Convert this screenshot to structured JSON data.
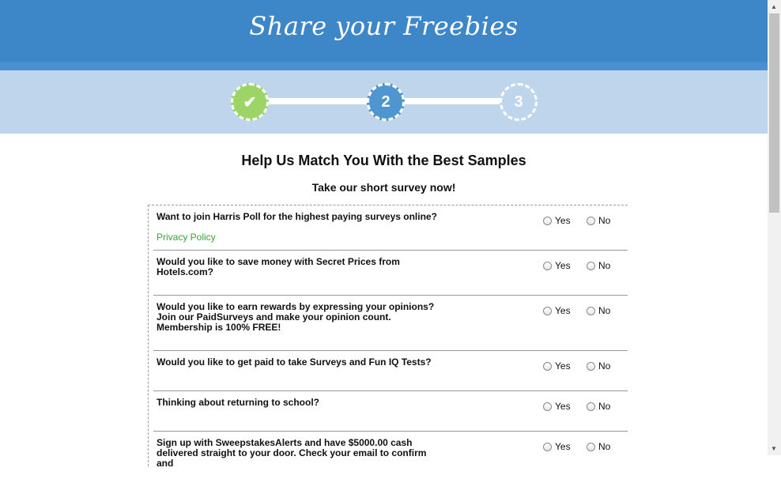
{
  "header": {
    "brand": "Share your Freebies"
  },
  "progress": {
    "steps": [
      {
        "label": "✔"
      },
      {
        "label": "2"
      },
      {
        "label": "3"
      }
    ]
  },
  "main": {
    "title": "Help Us Match You With the Best Samples",
    "subtitle": "Take our short survey now!",
    "yes_label": "Yes",
    "no_label": "No",
    "questions": [
      {
        "text": "Want to join Harris Poll for the highest paying surveys online?",
        "link": "Privacy Policy"
      },
      {
        "text": "Would you like to save money with Secret Prices from Hotels.com?"
      },
      {
        "text": "Would you like to earn rewards by expressing your opinions? Join our PaidSurveys and make your opinion count. Membership is 100% FREE!"
      },
      {
        "text": "Would you like to get paid to take Surveys and Fun IQ Tests?"
      },
      {
        "text": "Thinking about returning to school?"
      },
      {
        "text": "Sign up with SweepstakesAlerts and have $5000.00 cash delivered straight to your door. Check your email to confirm and"
      }
    ]
  },
  "scrollbar": {
    "up_icon": "▲",
    "down_icon": "▼"
  }
}
